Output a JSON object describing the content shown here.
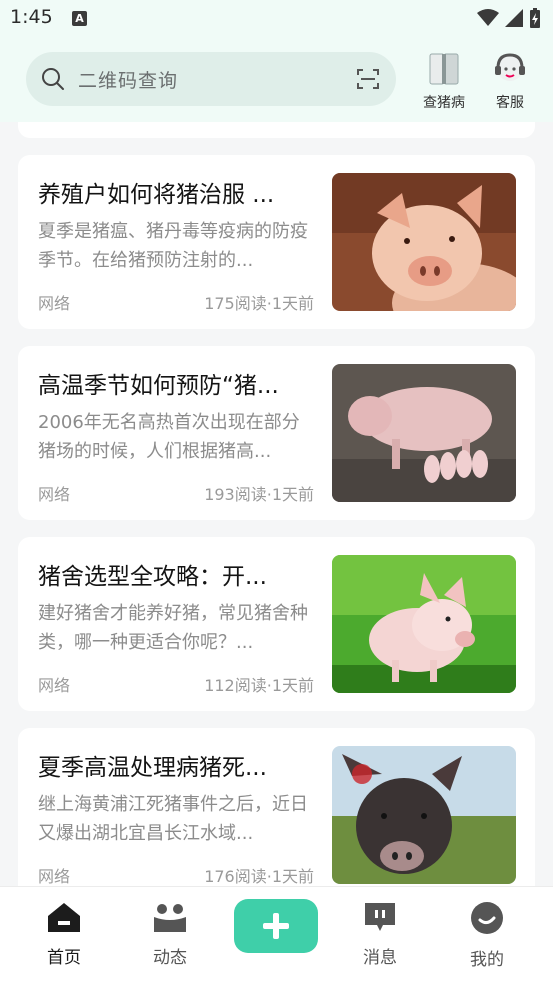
{
  "status": {
    "time": "1:45"
  },
  "search": {
    "placeholder": "二维码查询"
  },
  "header": {
    "check_disease_label": "查猪病",
    "customer_service_label": "客服"
  },
  "articles": [
    {
      "title": "养殖户如何将猪治服 ...",
      "summary": "夏季是猪瘟、猪丹毒等疫病的防疫季节。在给猪预防注射的...",
      "source": "网络",
      "meta": "175阅读·1天前"
    },
    {
      "title": "高温季节如何预防“猪...",
      "summary": "2006年无名高热首次出现在部分猪场的时候，人们根据猪高...",
      "source": "网络",
      "meta": "193阅读·1天前"
    },
    {
      "title": "猪舍选型全攻略：开...",
      "summary": "建好猪舍才能养好猪，常见猪舍种类，哪一种更适合你呢？...",
      "source": "网络",
      "meta": "112阅读·1天前"
    },
    {
      "title": "夏季高温处理病猪死...",
      "summary": "继上海黄浦江死猪事件之后，近日又爆出湖北宜昌长江水域...",
      "source": "网络",
      "meta": "176阅读·1天前"
    }
  ],
  "tabbar": {
    "home": "首页",
    "feed": "动态",
    "messages": "消息",
    "me": "我的"
  },
  "colors": {
    "accent": "#3fcfa9",
    "header_bg": "#f0fbf7",
    "search_bg": "#dfeee9"
  }
}
